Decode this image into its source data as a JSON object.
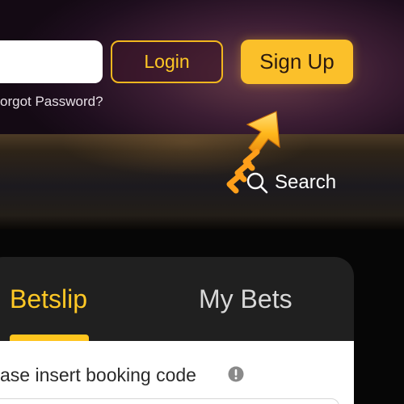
{
  "header": {
    "username_value": "",
    "forgot_password": "orgot Password?",
    "login_label": "Login",
    "signup_label": "Sign Up"
  },
  "search": {
    "label": "Search",
    "icon": "search-icon"
  },
  "pointer": {
    "icon": "pointer-arrow-icon",
    "color": "#ffb81c"
  },
  "betslip": {
    "tabs": [
      {
        "label": "Betslip",
        "active": true
      },
      {
        "label": "My Bets",
        "active": false
      }
    ],
    "booking_label": "ase insert booking code",
    "info_icon": "info-icon"
  },
  "colors": {
    "accent": "#fbc02a",
    "login_text": "#ffc825",
    "panel": "#202020"
  }
}
